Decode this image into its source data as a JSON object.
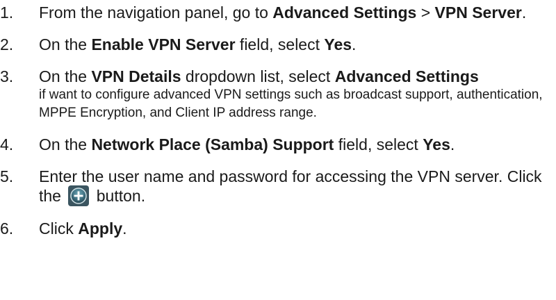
{
  "steps": [
    {
      "num": "1.",
      "t1": "From the navigation panel, go to ",
      "b1": "Advanced Settings",
      "t2": " > ",
      "b2": "VPN Server",
      "t3": "."
    },
    {
      "num": "2.",
      "t1": "On the ",
      "b1": "Enable VPN Server",
      "t2": " field, select ",
      "b2": "Yes",
      "t3": "."
    },
    {
      "num": "3.",
      "t1": "On the ",
      "b1": "VPN Details",
      "t2": " dropdown list, select ",
      "b2": "Advanced Settings",
      "t3": "if want to configure advanced VPN settings such as broadcast support, authentication, MPPE Encryption, and Client IP address range."
    },
    {
      "num": "4.",
      "t1": "On the ",
      "b1": "Network Place (Samba) Support",
      "t2": " field, select ",
      "b2": "Yes",
      "t3": "."
    },
    {
      "num": "5.",
      "t1": "Enter the user name and password for accessing the VPN server. Click the ",
      "t2": " button.",
      "icon": "add-circle-icon"
    },
    {
      "num": "6.",
      "t1": "Click ",
      "b1": "Apply",
      "t2": "."
    }
  ]
}
